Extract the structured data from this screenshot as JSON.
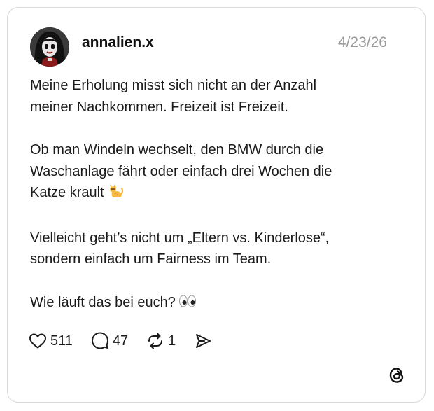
{
  "post": {
    "username": "annalien.x",
    "date": "4/23/26",
    "paragraphs": [
      "Meine Erholung misst sich nicht an der Anzahl\nmeiner Nachkommen. Freizeit ist Freizeit.",
      "Ob man Windeln wechselt, den BMW durch die\nWaschanlage fährt oder einfach drei Wochen die\nKatze krault",
      "Vielleicht geht’s nicht um „Eltern vs. Kinderlose“,\nsondern einfach um Fairness im Team.",
      "Wie läuft das bei euch?"
    ],
    "stats": {
      "likes": "511",
      "replies": "47",
      "reposts": "1"
    }
  },
  "icons": {
    "like": "heart-icon",
    "reply": "speech-bubble-icon",
    "repost": "repost-arrows-icon",
    "share": "send-icon",
    "brand": "threads-logo-icon",
    "cat_emoji": "cat-emoji-icon",
    "eyes_emoji": "eyes-emoji-icon"
  },
  "colors": {
    "text": "#1a1a1a",
    "muted": "#9a9a9a",
    "border": "#d9d9d9",
    "background": "#ffffff"
  }
}
